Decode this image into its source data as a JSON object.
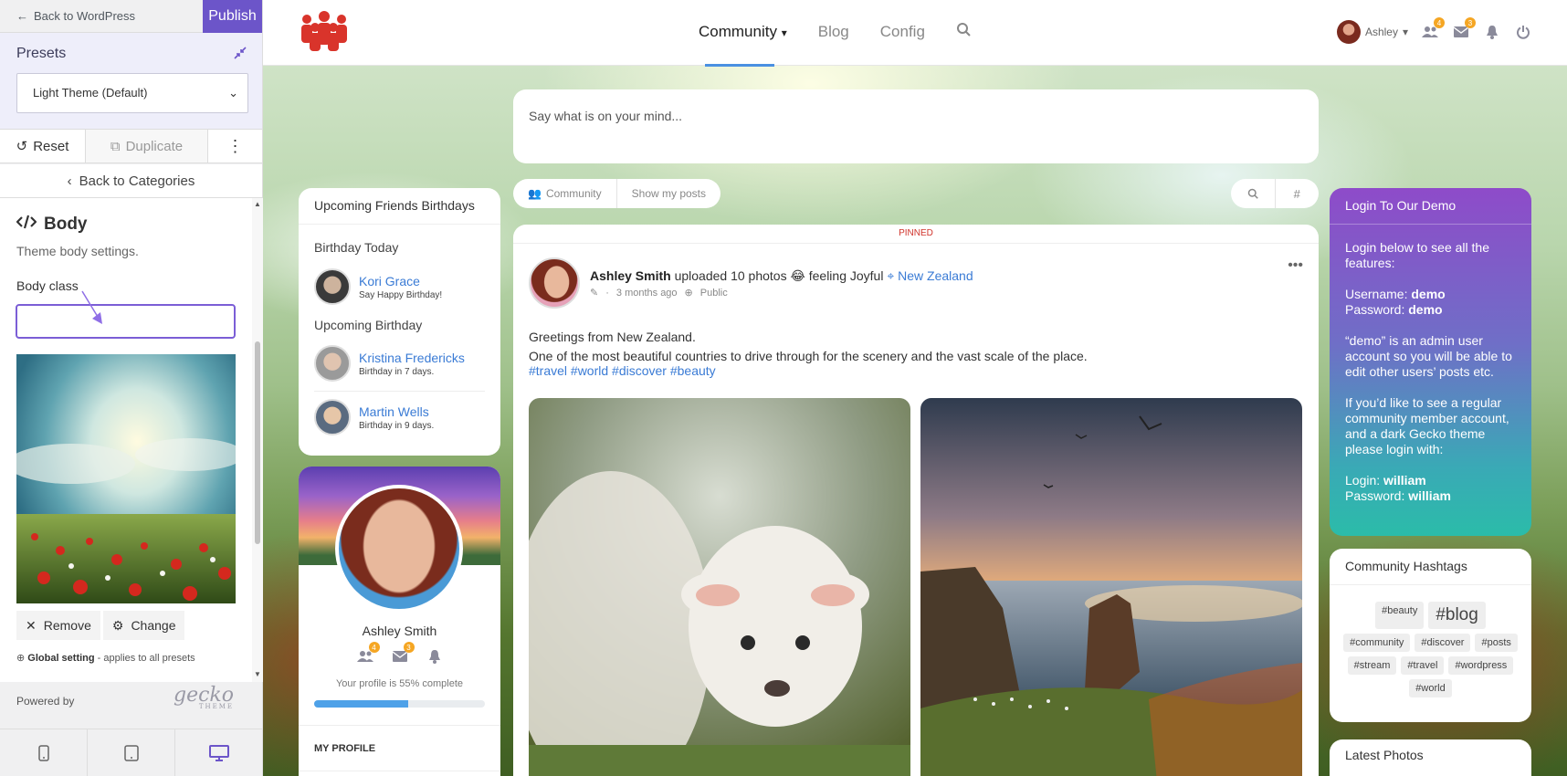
{
  "customizer": {
    "back_label": "Back to WordPress",
    "publish_label": "Publish",
    "presets_title": "Presets",
    "preset_selected": "Light Theme (Default)",
    "reset_label": "Reset",
    "duplicate_label": "Duplicate",
    "back_categories_label": "Back to Categories",
    "section_title": "Body",
    "section_desc": "Theme body settings.",
    "body_class_label": "Body class",
    "body_class_value": "",
    "remove_label": "Remove",
    "change_label": "Change",
    "global_setting_bold": "Global setting",
    "global_setting_rest": " - applies to all presets",
    "powered_by": "Powered by",
    "brand_name": "gecko",
    "brand_sub": "THEME",
    "accent_color": "#6c55c9"
  },
  "navbar": {
    "menu": [
      "Community",
      "Blog",
      "Config"
    ],
    "user_name": "Ashley",
    "badges": {
      "friends": "4",
      "messages": "3"
    }
  },
  "composer": {
    "placeholder": "Say what is on your mind..."
  },
  "filters": {
    "community": "Community",
    "my_posts": "Show my posts"
  },
  "birthdays": {
    "title": "Upcoming Friends Birthdays",
    "today_heading": "Birthday Today",
    "upcoming_heading": "Upcoming Birthday",
    "today": [
      {
        "name": "Kori Grace",
        "sub": "Say Happy Birthday!"
      }
    ],
    "upcoming": [
      {
        "name": "Kristina Fredericks",
        "sub": "Birthday in 7 days."
      },
      {
        "name": "Martin Wells",
        "sub": "Birthday in 9 days."
      }
    ]
  },
  "profile": {
    "name": "Ashley Smith",
    "complete_text": "Your profile is 55% complete",
    "complete_fraction": 0.55,
    "my_profile": "MY PROFILE",
    "badges": {
      "friends": "4",
      "messages": "3"
    }
  },
  "post": {
    "pinned": "PINNED",
    "author": "Ashley Smith",
    "action": " uploaded 10 photos ",
    "emoji": "😂",
    "feeling": " feeling Joyful ",
    "location": "New Zealand",
    "time": "3 months ago",
    "visibility": "Public",
    "line1": "Greetings from New Zealand.",
    "line2": "One of the most beautiful countries to drive through for the scenery and the vast scale of the place.",
    "tags": "#travel #world #discover #beauty"
  },
  "login": {
    "title": "Login To Our Demo",
    "intro": "Login below to see all the features:",
    "username_label": "Username: ",
    "username": "demo",
    "password_label": "Password: ",
    "password": "demo",
    "admin_note": "“demo” is an admin user account so you will be able to edit other users’ posts etc.",
    "member_note": "If you’d like to see a regular community member account, and a dark Gecko theme please login with:",
    "login_label": "Login: ",
    "login2": "william",
    "password2_label": "Password: ",
    "password2": "william"
  },
  "hashtags": {
    "title": "Community Hashtags",
    "tags": [
      "#beauty",
      "#blog",
      "#community",
      "#discover",
      "#posts",
      "#stream",
      "#travel",
      "#wordpress",
      "#world"
    ]
  },
  "latest_photos": {
    "title": "Latest Photos"
  }
}
